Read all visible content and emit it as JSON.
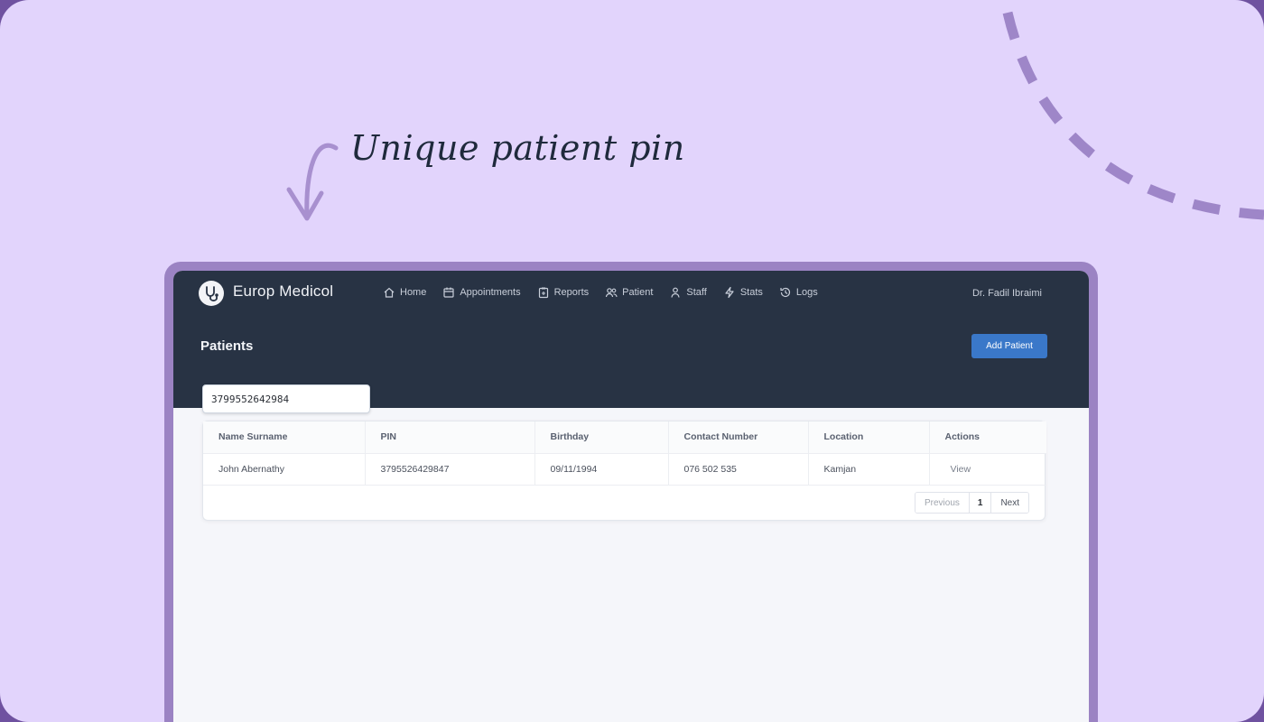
{
  "caption": "Unique patient pin",
  "app": {
    "brand": "Europ Medicol",
    "user": "Dr. Fadil Ibraimi",
    "nav": [
      {
        "label": "Home",
        "icon": "home-icon"
      },
      {
        "label": "Appointments",
        "icon": "calendar-icon"
      },
      {
        "label": "Reports",
        "icon": "clipboard-icon"
      },
      {
        "label": "Patient",
        "icon": "users-icon"
      },
      {
        "label": "Staff",
        "icon": "user-icon"
      },
      {
        "label": "Stats",
        "icon": "lightning-icon"
      },
      {
        "label": "Logs",
        "icon": "history-icon"
      }
    ],
    "page_title": "Patients",
    "add_button": "Add Patient",
    "search_value": "3799552642984",
    "table": {
      "headers": [
        "Name Surname",
        "PIN",
        "Birthday",
        "Contact Number",
        "Location",
        "Actions"
      ],
      "rows": [
        {
          "name": "John Abernathy",
          "pin": "3795526429847",
          "birthday": "09/11/1994",
          "contact": "076 502 535",
          "location": "Kamjan",
          "action": "View"
        }
      ]
    },
    "pagination": {
      "previous": "Previous",
      "page": "1",
      "next": "Next"
    }
  },
  "colors": {
    "background": "#e2d4fc",
    "accent_purple": "#9b83c3",
    "header_dark": "#283344",
    "primary_button": "#3a78c9"
  }
}
